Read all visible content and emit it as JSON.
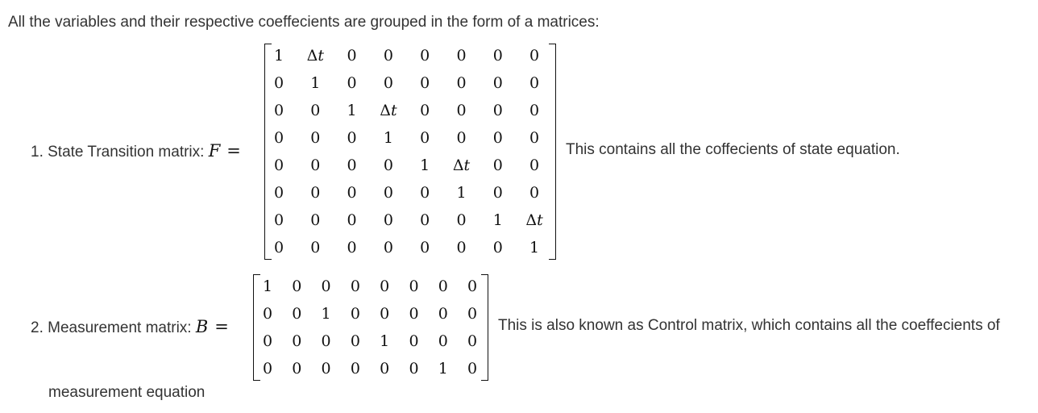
{
  "intro": "All the variables and their respective coeffecients are grouped in the form of a matrices:",
  "state": {
    "label": "1. State Transition matrix: ",
    "symbol": "F",
    "equals": "=",
    "matrix": [
      [
        "1",
        "Δt",
        "0",
        "0",
        "0",
        "0",
        "0",
        "0"
      ],
      [
        "0",
        "1",
        "0",
        "0",
        "0",
        "0",
        "0",
        "0"
      ],
      [
        "0",
        "0",
        "1",
        "Δt",
        "0",
        "0",
        "0",
        "0"
      ],
      [
        "0",
        "0",
        "0",
        "1",
        "0",
        "0",
        "0",
        "0"
      ],
      [
        "0",
        "0",
        "0",
        "0",
        "1",
        "Δt",
        "0",
        "0"
      ],
      [
        "0",
        "0",
        "0",
        "0",
        "0",
        "1",
        "0",
        "0"
      ],
      [
        "0",
        "0",
        "0",
        "0",
        "0",
        "0",
        "1",
        "Δt"
      ],
      [
        "0",
        "0",
        "0",
        "0",
        "0",
        "0",
        "0",
        "1"
      ]
    ],
    "description": "This contains all the coffecients of state equation."
  },
  "measurement": {
    "label": "2. Measurement matrix: ",
    "symbol": "B",
    "equals": "=",
    "matrix": [
      [
        "1",
        "0",
        "0",
        "0",
        "0",
        "0",
        "0",
        "0"
      ],
      [
        "0",
        "0",
        "1",
        "0",
        "0",
        "0",
        "0",
        "0"
      ],
      [
        "0",
        "0",
        "0",
        "0",
        "1",
        "0",
        "0",
        "0"
      ],
      [
        "0",
        "0",
        "0",
        "0",
        "0",
        "0",
        "1",
        "0"
      ]
    ],
    "description": "This is also known as Control matrix, which contains all the coeffecients of",
    "description_continued": "measurement equation"
  }
}
